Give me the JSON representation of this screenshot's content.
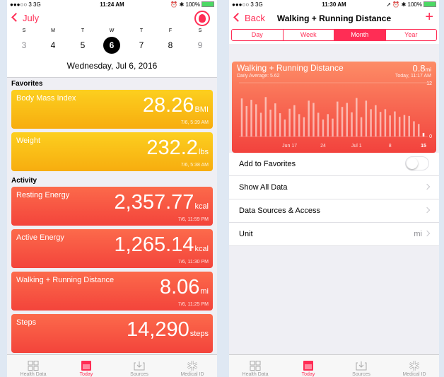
{
  "left": {
    "status": {
      "carrier": "●●●○○ 3  3G",
      "time": "11:24 AM",
      "right": "⏰ ✱ 100%"
    },
    "back_label": "July",
    "week": {
      "letters": [
        "S",
        "M",
        "T",
        "W",
        "T",
        "F",
        "S"
      ],
      "days": [
        "3",
        "4",
        "5",
        "6",
        "7",
        "8",
        "9"
      ],
      "selected_index": 3
    },
    "full_date": "Wednesday, Jul 6, 2016",
    "favorites_header": "Favorites",
    "favorites": [
      {
        "title": "Body Mass Index",
        "value": "28.26",
        "unit": "BMI",
        "time": "7/6, 5:39 AM"
      },
      {
        "title": "Weight",
        "value": "232.2",
        "unit": "lbs",
        "time": "7/6, 5:38 AM"
      }
    ],
    "activity_header": "Activity",
    "activity": [
      {
        "title": "Resting Energy",
        "value": "2,357.77",
        "unit": "kcal",
        "time": "7/6, 11:59 PM"
      },
      {
        "title": "Active Energy",
        "value": "1,265.14",
        "unit": "kcal",
        "time": "7/6, 11:30 PM"
      },
      {
        "title": "Walking + Running Distance",
        "value": "8.06",
        "unit": "mi",
        "time": "7/6, 11:25 PM"
      },
      {
        "title": "Steps",
        "value": "14,290",
        "unit": "steps",
        "time": ""
      }
    ],
    "tabs": [
      "Health Data",
      "Today",
      "Sources",
      "Medical ID"
    ],
    "active_tab": 1
  },
  "right": {
    "status": {
      "carrier": "●●●○○ 3  3G",
      "time": "11:30 AM",
      "right": "➚ ⏰ ✱ 100%"
    },
    "back_label": "Back",
    "title": "Walking + Running Distance",
    "segments": [
      "Day",
      "Week",
      "Month",
      "Year"
    ],
    "active_segment": 2,
    "chart": {
      "title": "Walking + Running Distance",
      "subtitle": "Daily Average: 5.62",
      "value": "0.8",
      "unit": "mi",
      "time": "Today, 11:17 AM",
      "ymax_label": "12",
      "ymin_label": "0"
    },
    "rows": [
      {
        "label": "Add to Favorites",
        "value": ""
      },
      {
        "label": "Show All Data",
        "value": ""
      },
      {
        "label": "Data Sources & Access",
        "value": ""
      },
      {
        "label": "Unit",
        "value": "mi"
      }
    ],
    "tabs": [
      "Health Data",
      "Today",
      "Sources",
      "Medical ID"
    ],
    "active_tab": 1
  },
  "chart_data": {
    "type": "bar",
    "title": "Walking + Running Distance",
    "subtitle": "Daily Average: 5.62",
    "categories": [
      "Jun 7",
      "Jun 8",
      "Jun 9",
      "Jun 10",
      "Jun 11",
      "Jun 12",
      "Jun 13",
      "Jun 14",
      "Jun 15",
      "Jun 16",
      "Jun 17",
      "Jun 18",
      "Jun 19",
      "Jun 20",
      "Jun 21",
      "Jun 22",
      "Jun 23",
      "Jun 24",
      "Jun 25",
      "Jun 26",
      "Jun 27",
      "Jun 28",
      "Jun 29",
      "Jun 30",
      "Jul 1",
      "Jul 2",
      "Jul 3",
      "Jul 4",
      "Jul 5",
      "Jul 6",
      "Jul 7",
      "Jul 8",
      "Jul 9",
      "Jul 10",
      "Jul 11",
      "Jul 12",
      "Jul 13",
      "Jul 14",
      "Jul 15"
    ],
    "values": [
      8.5,
      6.8,
      8.2,
      7.2,
      5.3,
      8.8,
      6.0,
      7.4,
      5.2,
      3.8,
      6.2,
      7.0,
      5.0,
      4.3,
      8.0,
      7.5,
      5.3,
      3.8,
      5.0,
      4.0,
      7.8,
      6.6,
      7.5,
      5.4,
      8.6,
      4.3,
      8.0,
      6.1,
      7.0,
      5.5,
      6.1,
      4.7,
      5.6,
      4.4,
      4.8,
      4.6,
      3.4,
      2.8,
      0.8
    ],
    "x_tick_labels": [
      "Jun 17",
      "24",
      "Jul 1",
      "8",
      "15"
    ],
    "ylim": [
      0,
      12
    ],
    "xlabel": "",
    "ylabel": ""
  }
}
